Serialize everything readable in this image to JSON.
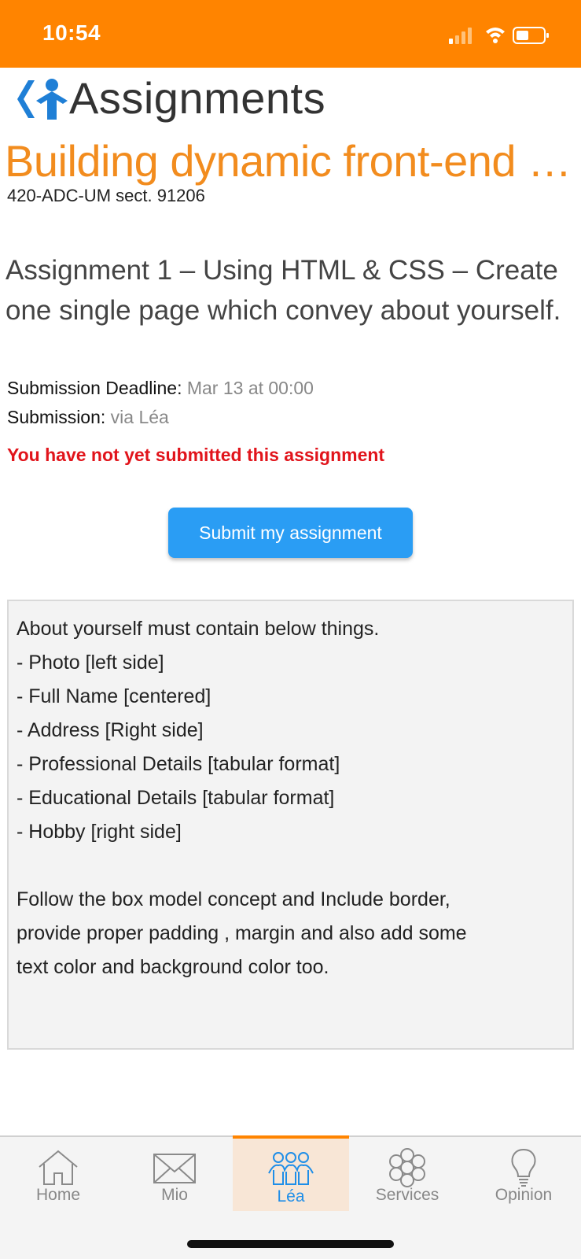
{
  "status_bar": {
    "time": "10:54"
  },
  "header": {
    "title": "Assignments"
  },
  "course": {
    "title": "Building dynamic front-end …",
    "code": "420-ADC-UM sect. 91206"
  },
  "assignment": {
    "title": "Assignment 1 – Using HTML & CSS – Create one single page which convey about yourself.",
    "deadline_label": "Submission Deadline:",
    "deadline_value": "Mar 13 at 00:00",
    "submission_label": "Submission:",
    "submission_value": "via Léa",
    "status_warning": "You have not yet submitted this assignment",
    "submit_button": "Submit my assignment",
    "description_lines": [
      "About yourself must contain below things.",
      "- Photo [left side]",
      "- Full Name [centered]",
      "- Address [Right side]",
      "- Professional Details [tabular format]",
      "- Educational Details [tabular format]",
      "- Hobby [right side]",
      "",
      "Follow the box model concept and Include border,",
      "provide proper padding , margin and also add some",
      "text color and background color too."
    ]
  },
  "tabs": [
    {
      "label": "Home",
      "icon": "home-icon",
      "active": false
    },
    {
      "label": "Mio",
      "icon": "mail-icon",
      "active": false
    },
    {
      "label": "Léa",
      "icon": "people-icon",
      "active": true
    },
    {
      "label": "Services",
      "icon": "flower-icon",
      "active": false
    },
    {
      "label": "Opinion",
      "icon": "lightbulb-icon",
      "active": false
    }
  ],
  "colors": {
    "brand_orange": "#ff8400",
    "course_title": "#f28c1e",
    "accent_blue": "#2a9df4",
    "warning_red": "#e1141b"
  }
}
